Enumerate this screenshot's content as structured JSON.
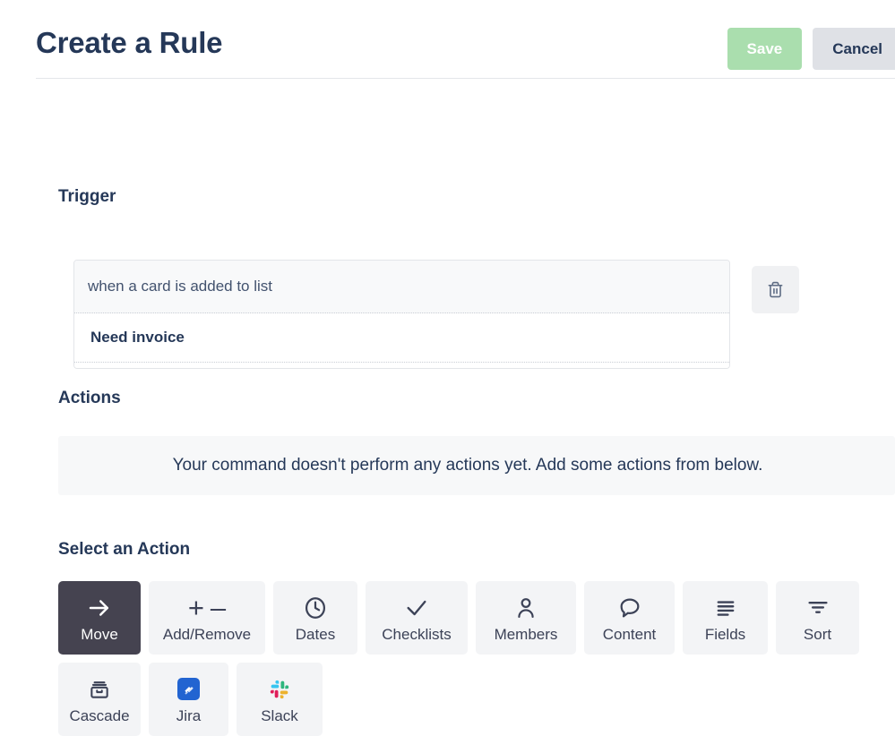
{
  "header": {
    "title": "Create a Rule",
    "save_label": "Save",
    "cancel_label": "Cancel"
  },
  "trigger": {
    "heading": "Trigger",
    "condition_text": "when a card is added to list",
    "list_name": "Need invoice",
    "delete_icon": "trash-icon"
  },
  "actions": {
    "heading": "Actions",
    "empty_message": "Your command doesn't perform any actions yet. Add some actions from below."
  },
  "select_action": {
    "heading": "Select an Action",
    "tiles": [
      {
        "label": "Move",
        "icon": "arrow-right-icon",
        "selected": true
      },
      {
        "label": "Add/Remove",
        "icon": "plus-minus-icon",
        "selected": false
      },
      {
        "label": "Dates",
        "icon": "clock-icon",
        "selected": false
      },
      {
        "label": "Checklists",
        "icon": "check-icon",
        "selected": false
      },
      {
        "label": "Members",
        "icon": "person-icon",
        "selected": false
      },
      {
        "label": "Content",
        "icon": "speech-bubble-icon",
        "selected": false
      },
      {
        "label": "Fields",
        "icon": "lines-icon",
        "selected": false
      },
      {
        "label": "Sort",
        "icon": "sort-funnel-icon",
        "selected": false
      },
      {
        "label": "Cascade",
        "icon": "archive-icon",
        "selected": false
      },
      {
        "label": "Jira",
        "icon": "jira-icon",
        "selected": false
      },
      {
        "label": "Slack",
        "icon": "slack-icon",
        "selected": false
      }
    ],
    "plus_glyph": "+",
    "minus_glyph": "–"
  },
  "colors": {
    "accent_dark": "#253858",
    "save_green": "#aadeae",
    "cancel_gray": "#dfe1e6",
    "tile_bg": "#f3f4f6",
    "tile_selected_bg": "#454350",
    "jira_blue": "#2264d1"
  }
}
